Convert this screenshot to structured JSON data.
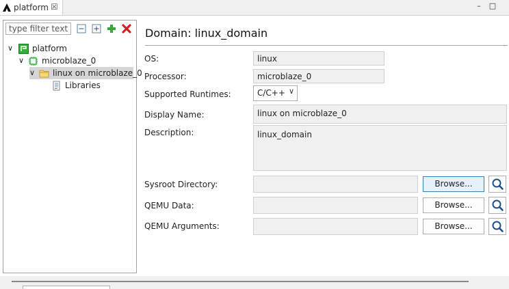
{
  "tab": {
    "label": "platform",
    "close": "☒"
  },
  "window_buttons": {
    "minimize": "–",
    "maximize": "□"
  },
  "left": {
    "filter_placeholder": "type filter text",
    "tree": [
      {
        "label": "platform",
        "chevron": "∨"
      },
      {
        "label": "microblaze_0",
        "chevron": "∨"
      },
      {
        "label": "linux on microblaze_0",
        "chevron": "∨"
      },
      {
        "label": "Libraries"
      }
    ]
  },
  "domain": {
    "title": "Domain: linux_domain",
    "fields": {
      "os": {
        "label": "OS:",
        "value": "linux"
      },
      "processor": {
        "label": "Processor:",
        "value": "microblaze_0"
      },
      "runtimes": {
        "label": "Supported Runtimes:",
        "value": "C/C++"
      },
      "display_name": {
        "label": "Display Name:",
        "value": "linux on microblaze_0"
      },
      "description": {
        "label": "Description:",
        "value": "linux_domain"
      },
      "sysroot": {
        "label": "Sysroot Directory:",
        "value": ""
      },
      "qemu_data": {
        "label": "QEMU Data:",
        "value": ""
      },
      "qemu_args": {
        "label": "QEMU Arguments:",
        "value": ""
      }
    },
    "browse_label": "Browse..."
  },
  "colors": {
    "accent": "#3c7fb1",
    "add_green": "#3aa63a",
    "delete_red": "#d32020",
    "chip_green": "#2fae3a"
  }
}
